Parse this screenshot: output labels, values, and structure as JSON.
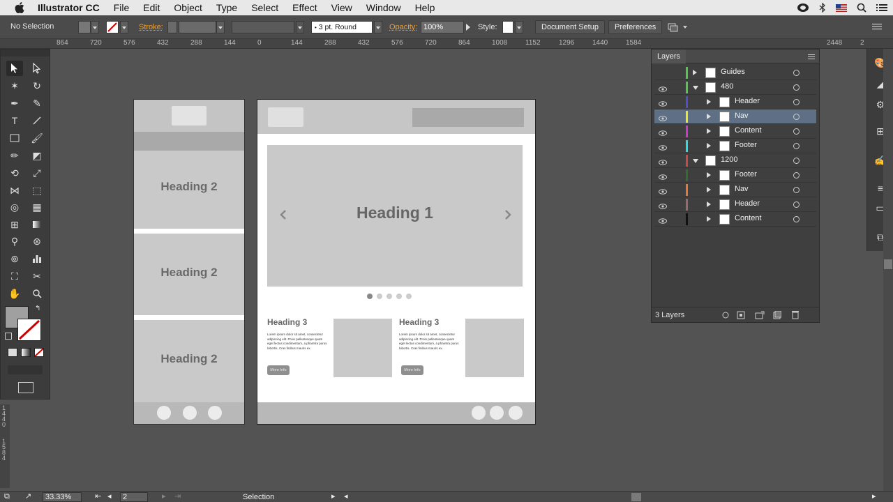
{
  "menubar": {
    "app_name": "Illustrator CC",
    "items": [
      "File",
      "Edit",
      "Object",
      "Type",
      "Select",
      "Effect",
      "View",
      "Window",
      "Help"
    ]
  },
  "controlbar": {
    "selection": "No Selection",
    "stroke_label": "Stroke:",
    "brush_value": "3 pt. Round",
    "opacity_label": "Opacity:",
    "opacity_value": "100%",
    "style_label": "Style:",
    "document_setup": "Document Setup",
    "preferences": "Preferences"
  },
  "ruler": {
    "ticks": [
      "864",
      "720",
      "576",
      "432",
      "288",
      "144",
      "0",
      "144",
      "288",
      "432",
      "576",
      "720",
      "864",
      "1008",
      "1152",
      "1296",
      "1440",
      "1584",
      "2448",
      "2"
    ]
  },
  "vruler": {
    "ticks": [
      "1",
      "4",
      "4",
      "0",
      "1",
      "5",
      "8",
      "4"
    ]
  },
  "mobile": {
    "heading_1": "Heading 2",
    "heading_2": "Heading 2",
    "heading_3": "Heading 2"
  },
  "desktop": {
    "hero_heading": "Heading 1",
    "card1_heading": "Heading 3",
    "card2_heading": "Heading 3",
    "card1_body": "Lorem ipsum dolor sit amet, consectetur adipiscing elit. Proin pellentesque quam eget lectus condimentum, a pharetra purus lobortis. Cras finibus mauris ex.",
    "card2_body": "Lorem ipsum dolor sit amet, consectetur adipiscing elit. Proin pellentesque quam eget lectus condimentum, a pharetra purus lobortis. Cras finibus mauris ex.",
    "more_info": "More Info",
    "carousel_dots": 5,
    "active_dot": 0
  },
  "layers": {
    "title": "Layers",
    "count_label": "3 Layers",
    "rows": [
      {
        "name": "Guides",
        "color": "#52c84a",
        "depth": 0,
        "twist": "closed",
        "visible": false,
        "selected": false
      },
      {
        "name": "480",
        "color": "#52c84a",
        "depth": 0,
        "twist": "open",
        "visible": true,
        "selected": false
      },
      {
        "name": "Header",
        "color": "#5050c8",
        "depth": 1,
        "twist": "closed",
        "visible": true,
        "selected": false
      },
      {
        "name": "Nav",
        "color": "#e6e62a",
        "depth": 1,
        "twist": "closed",
        "visible": true,
        "selected": true
      },
      {
        "name": "Content",
        "color": "#c83cc8",
        "depth": 1,
        "twist": "closed",
        "visible": true,
        "selected": false
      },
      {
        "name": "Footer",
        "color": "#2adede",
        "depth": 1,
        "twist": "closed",
        "visible": true,
        "selected": false
      },
      {
        "name": "1200",
        "color": "#c84a4a",
        "depth": 0,
        "twist": "open",
        "visible": true,
        "selected": false
      },
      {
        "name": "Footer",
        "color": "#2f6e2f",
        "depth": 1,
        "twist": "closed",
        "visible": true,
        "selected": false
      },
      {
        "name": "Nav",
        "color": "#e07a3a",
        "depth": 1,
        "twist": "closed",
        "visible": true,
        "selected": false
      },
      {
        "name": "Header",
        "color": "#9a6a6a",
        "depth": 1,
        "twist": "closed",
        "visible": true,
        "selected": false
      },
      {
        "name": "Content",
        "color": "#111111",
        "depth": 1,
        "twist": "closed",
        "visible": true,
        "selected": false
      }
    ]
  },
  "statusbar": {
    "zoom": "33.33%",
    "page": "2",
    "mode": "Selection"
  }
}
